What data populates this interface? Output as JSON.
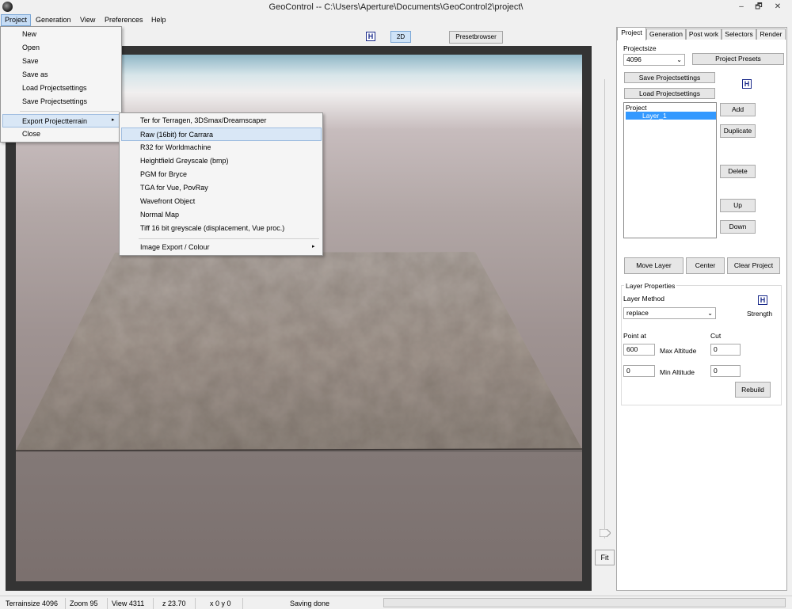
{
  "window": {
    "title": "GeoControl --  C:\\Users\\Aperture\\Documents\\GeoControl2\\project\\",
    "minimize": "–",
    "maximize": "🗗",
    "close": "✕"
  },
  "menubar": [
    "Project",
    "Generation",
    "View",
    "Preferences",
    "Help"
  ],
  "project_menu": {
    "items": [
      "New",
      "Open",
      "Save",
      "Save as",
      "Load Projectsettings",
      "Save Projectsettings",
      "Export Projectterrain",
      "Close"
    ],
    "highlighted": "Export Projectterrain"
  },
  "export_submenu": {
    "items": [
      "Ter for Terragen, 3DSmax/Dreamscaper",
      "Raw (16bit) for Carrara",
      "R32 for Worldmachine",
      "Heightfield Greyscale (bmp)",
      "PGM for Bryce",
      "TGA for Vue, PovRay",
      "Wavefront Object",
      "Normal Map",
      "Tiff 16 bit greyscale (displacement, Vue proc.)",
      "Image Export / Colour"
    ],
    "highlighted": "Raw (16bit) for Carrara"
  },
  "viewport_toolbar": {
    "h_icon": "H",
    "btn_2d": "2D",
    "presetbrowser": "Presetbrowser"
  },
  "fit_label": "Fit",
  "panel": {
    "tabs": [
      "Project",
      "Generation",
      "Post work",
      "Selectors",
      "Render"
    ],
    "active_tab": "Project",
    "projectsize_label": "Projectsize",
    "projectsize_value": "4096",
    "project_presets": "Project Presets",
    "save_projectsettings": "Save Projectsettings",
    "load_projectsettings": "Load Projectsettings",
    "h_icon": "H",
    "tree_root": "Project",
    "tree_layer": "Layer_1",
    "add": "Add",
    "duplicate": "Duplicate",
    "delete": "Delete",
    "up": "Up",
    "down": "Down",
    "move_layer": "Move Layer",
    "center": "Center",
    "clear_project": "Clear Project",
    "layer_properties": "Layer Properties",
    "layer_method_label": "Layer Method",
    "layer_method_value": "replace",
    "strength_label": "Strength",
    "point_at_label": "Point at",
    "cut_label": "Cut",
    "max_altitude_value": "600",
    "max_altitude_label": "Max Altitude",
    "max_cut_value": "0",
    "min_altitude_value": "0",
    "min_altitude_label": "Min Altitude",
    "min_cut_value": "0",
    "rebuild": "Rebuild"
  },
  "statusbar": {
    "terrainsize": "Terrainsize  4096",
    "zoom": "Zoom  95",
    "view": "View  4311",
    "z": "z 23.70",
    "xy": "x 0 y 0",
    "status": "Saving done"
  },
  "colors": {
    "menu_highlight": "#c5dcf5",
    "tree_selection": "#3399ff",
    "h_icon_blue": "#1a2a8a",
    "viewport_frame": "#343434"
  }
}
